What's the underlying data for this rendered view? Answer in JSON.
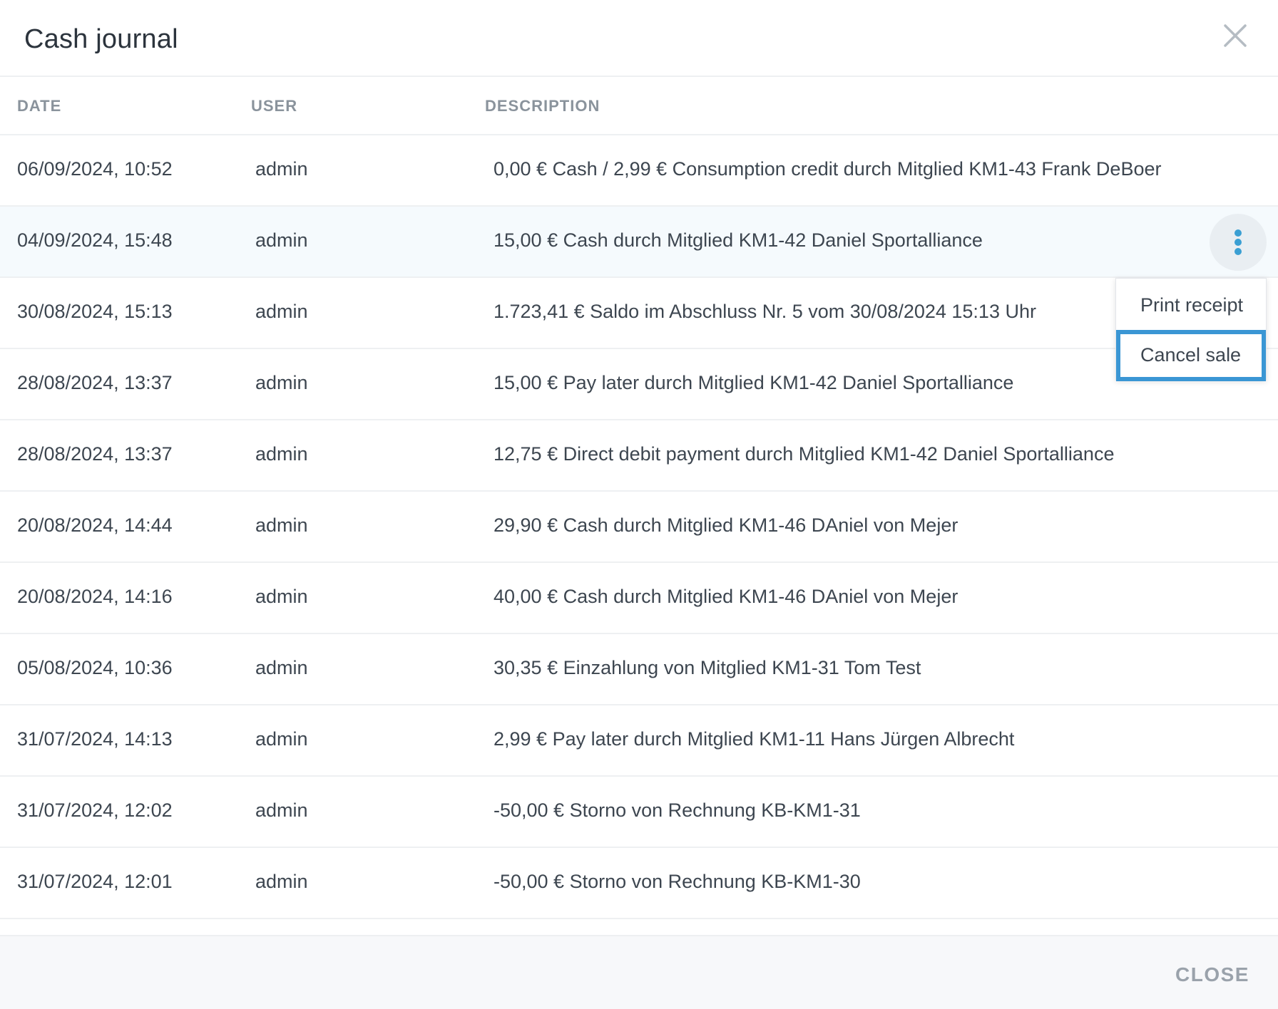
{
  "dialog": {
    "title": "Cash journal",
    "close_label": "CLOSE"
  },
  "columns": {
    "date": "DATE",
    "user": "USER",
    "description": "DESCRIPTION"
  },
  "rows": [
    {
      "date": "06/09/2024, 10:52",
      "user": "admin",
      "description": "0,00 € Cash / 2,99 € Consumption credit durch Mitglied KM1-43 Frank DeBoer"
    },
    {
      "date": "04/09/2024, 15:48",
      "user": "admin",
      "description": "15,00 € Cash durch Mitglied KM1-42 Daniel Sportalliance"
    },
    {
      "date": "30/08/2024, 15:13",
      "user": "admin",
      "description": "1.723,41 € Saldo im Abschluss Nr. 5 vom 30/08/2024 15:13 Uhr"
    },
    {
      "date": "28/08/2024, 13:37",
      "user": "admin",
      "description": "15,00 € Pay later durch Mitglied KM1-42 Daniel Sportalliance"
    },
    {
      "date": "28/08/2024, 13:37",
      "user": "admin",
      "description": "12,75 € Direct debit payment durch Mitglied KM1-42 Daniel Sportalliance"
    },
    {
      "date": "20/08/2024, 14:44",
      "user": "admin",
      "description": "29,90 € Cash durch Mitglied KM1-46 DAniel von Mejer"
    },
    {
      "date": "20/08/2024, 14:16",
      "user": "admin",
      "description": "40,00 € Cash durch Mitglied KM1-46 DAniel von Mejer"
    },
    {
      "date": "05/08/2024, 10:36",
      "user": "admin",
      "description": "30,35 € Einzahlung von Mitglied KM1-31 Tom Test"
    },
    {
      "date": "31/07/2024, 14:13",
      "user": "admin",
      "description": "2,99 € Pay later durch Mitglied KM1-11 Hans Jürgen Albrecht"
    },
    {
      "date": "31/07/2024, 12:02",
      "user": "admin",
      "description": "-50,00 € Storno von Rechnung KB-KM1-31"
    },
    {
      "date": "31/07/2024, 12:01",
      "user": "admin",
      "description": "-50,00 € Storno von Rechnung KB-KM1-30"
    }
  ],
  "context_menu": {
    "items": [
      "Print receipt",
      "Cancel sale"
    ],
    "focused_item": "Cancel sale"
  },
  "icons": {
    "close": "close-icon",
    "more": "more-vertical-icon"
  },
  "colors": {
    "accent": "#3a96d4",
    "hover_row": "#f5fafd"
  }
}
